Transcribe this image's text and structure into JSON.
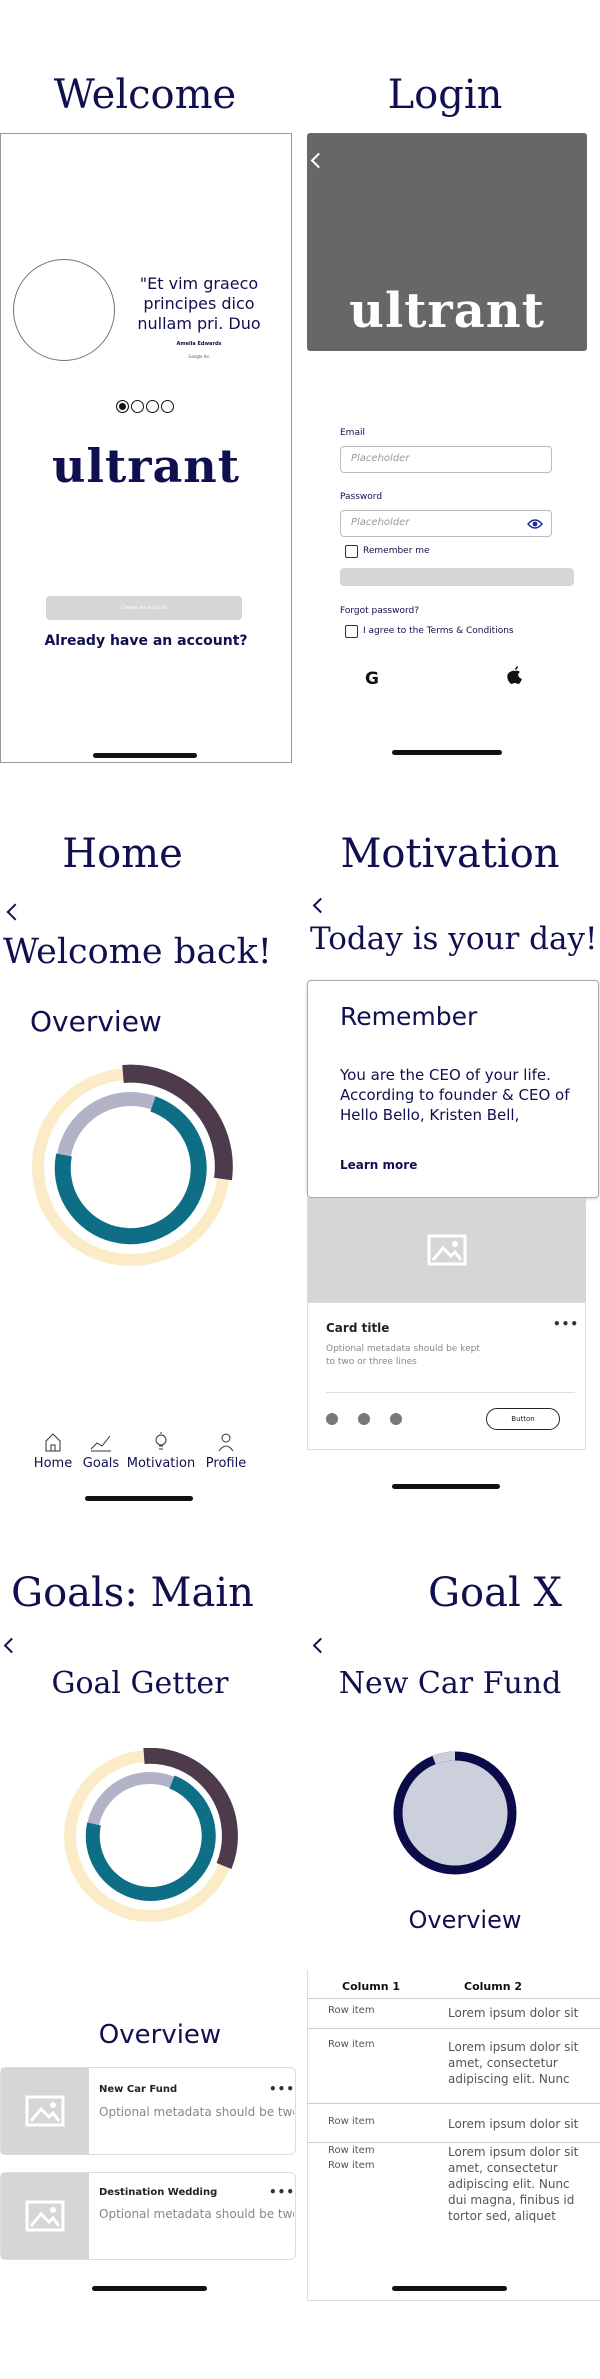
{
  "screens": {
    "welcome": {
      "title": "Welcome",
      "quote": "\"Et vim graeco principes dico nullam pri. Duo",
      "quote_author": "Amelia Edwards",
      "quote_source": "Google Inc",
      "logo": "ultrant",
      "create_button": "Create an account",
      "login_link": "Already have an account?"
    },
    "login": {
      "title": "Login",
      "logo": "ultrant",
      "email_label": "Email",
      "email_placeholder": "Placeholder",
      "password_label": "Password",
      "password_placeholder": "Placeholder",
      "remember_label": "Remember me",
      "forgot_label": "Forgot password?",
      "terms_label": "I agree to the Terms & Conditions",
      "google_icon": "google-icon",
      "apple_icon": "apple-icon"
    },
    "home": {
      "title": "Home",
      "welcome": "Welcome back!",
      "overview": "Overview",
      "tabs": [
        {
          "label": "Home",
          "icon": "house-icon"
        },
        {
          "label": "Goals",
          "icon": "chart-icon"
        },
        {
          "label": "Motivation",
          "icon": "lightbulb-icon"
        },
        {
          "label": "Profile",
          "icon": "person-icon"
        }
      ]
    },
    "motivation": {
      "title": "Motivation",
      "heading": "Today is your day!",
      "remember_title": "Remember",
      "remember_body": "You are the CEO of your life. According to founder & CEO of Hello Bello, Kristen Bell,",
      "learn_more": "Learn more",
      "card_title": "Card title",
      "card_meta": "Optional metadata should be kept to two or three lines",
      "card_button": "Button"
    },
    "goals_main": {
      "title": "Goals: Main",
      "heading": "Goal Getter",
      "overview": "Overview",
      "items": [
        {
          "title": "New Car Fund",
          "meta": "Optional metadata should be two"
        },
        {
          "title": "Destination Wedding",
          "meta": "Optional metadata should be two"
        }
      ]
    },
    "goal_x": {
      "title": "Goal X",
      "heading": "New Car Fund",
      "overview": "Overview",
      "columns": [
        "Column 1",
        "Column 2"
      ],
      "rows": [
        {
          "c1": "Row item",
          "c2": "Lorem ipsum dolor sit"
        },
        {
          "c1": "Row item",
          "c2": "Lorem ipsum dolor sit amet, consectetur adipiscing elit. Nunc dui"
        },
        {
          "c1": "Row item",
          "c2": "Lorem ipsum dolor sit"
        },
        {
          "c1": "Row item",
          "c2": ""
        },
        {
          "c1": "Row item",
          "c2": "Lorem ipsum dolor sit amet, consectetur adipiscing elit. Nunc dui magna, finibus id tortor sed, aliquet"
        }
      ]
    }
  },
  "colors": {
    "navy": "#101050",
    "teal": "#0e6e86",
    "plum": "#4d3a4a",
    "cream": "#fbebc6",
    "lilac": "#b3b3c8",
    "gray": "#676767"
  }
}
